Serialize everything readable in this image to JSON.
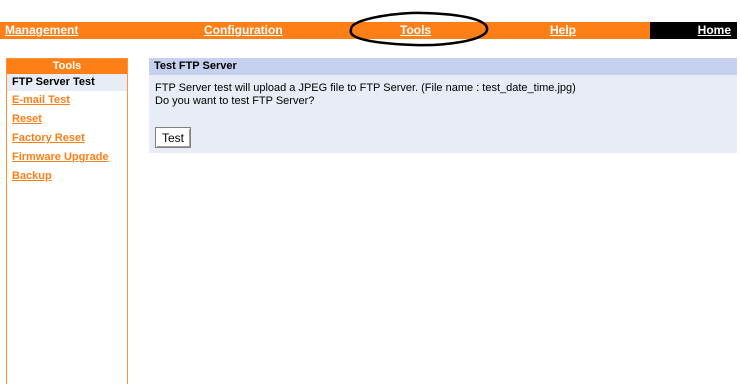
{
  "topnav": {
    "management": "Management",
    "configuration": "Configuration",
    "tools": "Tools",
    "help": "Help",
    "home": "Home"
  },
  "sidebar": {
    "title": "Tools",
    "items": [
      {
        "label": "FTP Server Test",
        "active": true
      },
      {
        "label": "E-mail Test",
        "active": false
      },
      {
        "label": "Reset",
        "active": false
      },
      {
        "label": "Factory Reset",
        "active": false
      },
      {
        "label": "Firmware Upgrade",
        "active": false
      },
      {
        "label": "Backup",
        "active": false
      }
    ]
  },
  "main": {
    "title": "Test FTP Server",
    "description_line1": "FTP Server test will upload a JPEG file to FTP Server. (File name : test_date_time.jpg)",
    "description_line2": "Do you want to test FTP Server?",
    "test_button": "Test"
  },
  "colors": {
    "accent": "#ff7f17",
    "title_bar": "#c6d0ef",
    "panel": "#e8ecf6"
  }
}
